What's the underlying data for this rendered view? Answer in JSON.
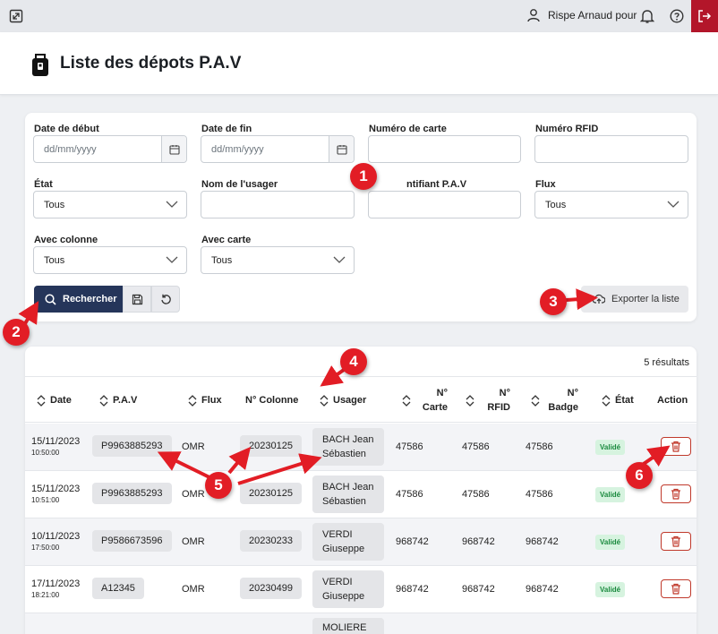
{
  "topbar": {
    "user_name": "Rispe Arnaud pour",
    "icons": [
      "expand-icon",
      "user-icon",
      "bell-icon",
      "help-icon",
      "logout-icon"
    ]
  },
  "page": {
    "title": "Liste des dépots P.A.V"
  },
  "filters": {
    "date_debut": {
      "label": "Date de début",
      "placeholder": "dd/mm/yyyy"
    },
    "date_fin": {
      "label": "Date de fin",
      "placeholder": "dd/mm/yyyy"
    },
    "numero_carte": {
      "label": "Numéro de carte",
      "value": ""
    },
    "numero_rfid": {
      "label": "Numéro RFID",
      "value": ""
    },
    "etat": {
      "label": "État",
      "value": "Tous"
    },
    "nom_usager": {
      "label": "Nom de l'usager",
      "value": ""
    },
    "identifiant_pav": {
      "label": "ntifiant P.A.V",
      "value": ""
    },
    "flux": {
      "label": "Flux",
      "value": "Tous"
    },
    "avec_colonne": {
      "label": "Avec colonne",
      "value": "Tous"
    },
    "avec_carte": {
      "label": "Avec carte",
      "value": "Tous"
    },
    "search_label": "Rechercher",
    "export_label": "Exporter la liste"
  },
  "results": {
    "count_text": "5 résultats",
    "headers": {
      "date": "Date",
      "pav": "P.A.V",
      "flux": "Flux",
      "colonne": "N° Colonne",
      "usager": "Usager",
      "carte": "N° Carte",
      "rfid": "N° RFID",
      "badge": "N° Badge",
      "etat": "État",
      "action": "Action"
    },
    "rows": [
      {
        "date": "15/11/2023",
        "time": "10:50:00",
        "pav": "P9963885293",
        "flux": "OMR",
        "colonne": "20230125",
        "usager": "BACH Jean Sébastien",
        "carte": "47586",
        "rfid": "47586",
        "badge": "47586",
        "etat": "Validé"
      },
      {
        "date": "15/11/2023",
        "time": "10:51:00",
        "pav": "P9963885293",
        "flux": "OMR",
        "colonne": "20230125",
        "usager": "BACH Jean Sébastien",
        "carte": "47586",
        "rfid": "47586",
        "badge": "47586",
        "etat": "Validé"
      },
      {
        "date": "10/11/2023",
        "time": "17:50:00",
        "pav": "P9586673596",
        "flux": "OMR",
        "colonne": "20230233",
        "usager": "VERDI Giuseppe",
        "carte": "968742",
        "rfid": "968742",
        "badge": "968742",
        "etat": "Validé"
      },
      {
        "date": "17/11/2023",
        "time": "18:21:00",
        "pav": "A12345",
        "flux": "OMR",
        "colonne": "20230499",
        "usager": "VERDI Giuseppe",
        "carte": "968742",
        "rfid": "968742",
        "badge": "968742",
        "etat": "Validé"
      },
      {
        "date": "",
        "time": "",
        "pav": "",
        "flux": "",
        "colonne": "",
        "usager": "MOLIERE",
        "carte": "",
        "rfid": "",
        "badge": "",
        "etat": ""
      }
    ]
  },
  "annotations": [
    "1",
    "2",
    "3",
    "4",
    "5",
    "6"
  ],
  "colors": {
    "primary": "#25355a",
    "logout": "#b3162a",
    "annotation": "#e21d25",
    "badge_bg": "#d6f3df",
    "badge_text": "#1a8a3e"
  }
}
